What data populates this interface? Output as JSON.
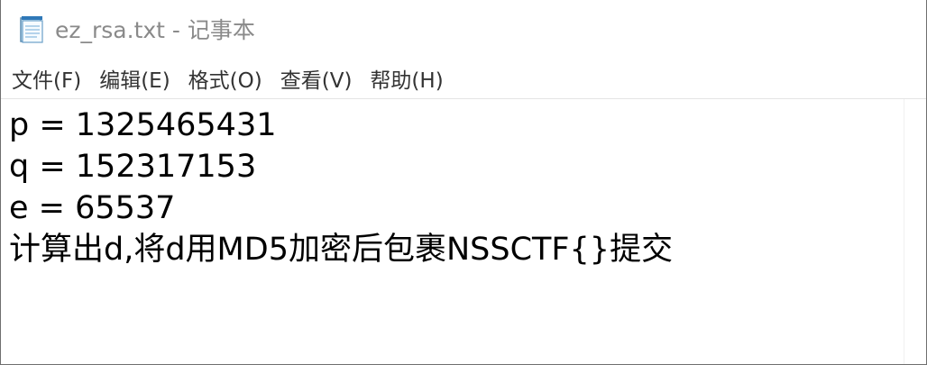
{
  "window": {
    "title": "ez_rsa.txt - 记事本",
    "icon": "notepad-icon"
  },
  "menu": {
    "items": [
      {
        "label": "文件(F)"
      },
      {
        "label": "编辑(E)"
      },
      {
        "label": "格式(O)"
      },
      {
        "label": "查看(V)"
      },
      {
        "label": "帮助(H)"
      }
    ]
  },
  "editor": {
    "lines": [
      "p = 1325465431",
      "q = 152317153",
      "e = 65537",
      "计算出d,将d用MD5加密后包裹NSSCTF{}提交"
    ]
  }
}
